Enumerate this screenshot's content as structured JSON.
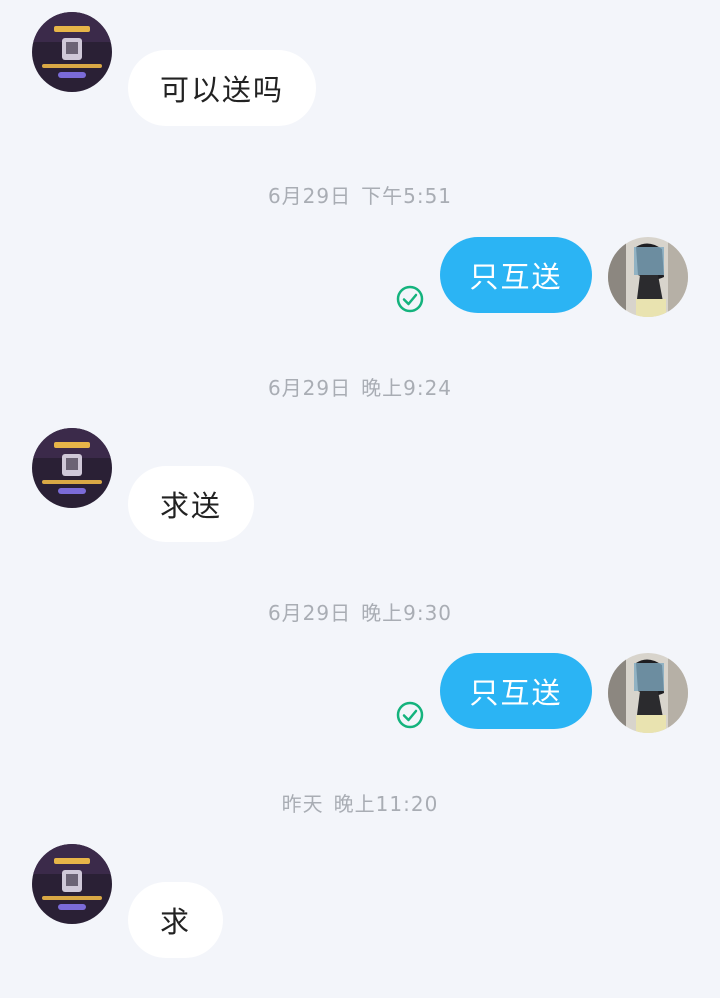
{
  "conversation": {
    "messages": [
      {
        "text": "可以送吗"
      },
      {
        "text": "只互送",
        "status_icon": "read-check-icon"
      },
      {
        "text": "求送"
      },
      {
        "text": "只互送",
        "status_icon": "read-check-icon"
      },
      {
        "text": "求"
      }
    ],
    "timestamps": [
      {
        "date": "6月29日",
        "time": "下午5:51"
      },
      {
        "date": "6月29日",
        "time": "晚上9:24"
      },
      {
        "date": "6月29日",
        "time": "晚上9:30"
      },
      {
        "date": "昨天",
        "time": "晚上11:20"
      }
    ]
  },
  "colors": {
    "background": "#f3f5fa",
    "incoming_bubble": "#ffffff",
    "outgoing_bubble": "#2bb4f4",
    "read_check": "#14b37d",
    "timestamp_text": "#a9adb4"
  }
}
